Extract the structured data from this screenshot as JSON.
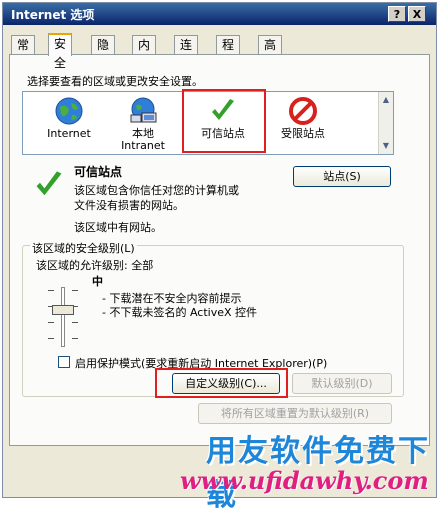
{
  "window": {
    "title": "Internet 选项",
    "help_glyph": "?",
    "close_glyph": "X"
  },
  "tabs": [
    {
      "label": "常规"
    },
    {
      "label": "安全"
    },
    {
      "label": "隐私"
    },
    {
      "label": "内容"
    },
    {
      "label": "连接"
    },
    {
      "label": "程序"
    },
    {
      "label": "高级"
    }
  ],
  "zones_heading": "选择要查看的区域或更改安全设置。",
  "zones": [
    {
      "label": "Internet",
      "icon": "globe-icon"
    },
    {
      "label": "本地\nIntranet",
      "icon": "intranet-icon"
    },
    {
      "label": "可信站点",
      "icon": "checkmark-icon"
    },
    {
      "label": "受限站点",
      "icon": "restricted-icon"
    }
  ],
  "selected_zone": {
    "title": "可信站点",
    "desc_line1": "该区域包含你信任对您的计算机或",
    "desc_line2": "文件没有损害的网站。",
    "desc_line3": "该区域中有网站。",
    "sites_button": "站点(S)"
  },
  "security_level": {
    "group_label": "该区域的安全级别(L)",
    "allowed": "该区域的允许级别: 全部",
    "level": "中",
    "bullet1": "- 下载潜在不安全内容前提示",
    "bullet2": "- 不下载未签名的 ActiveX 控件"
  },
  "protected_mode": {
    "label": "启用保护模式(要求重新启动 Internet Explorer)(P)",
    "checked": false
  },
  "buttons": {
    "custom_level": "自定义级别(C)...",
    "default_level": "默认级别(D)",
    "reset_all": "将所有区域重置为默认级别(R)"
  },
  "watermark": {
    "cn": "用友软件免费下载",
    "en": "www.ufidawhy.com"
  },
  "colors": {
    "title_bar": "#0a246a",
    "highlight_red": "#e02020",
    "watermark_blue": "#1e86d8",
    "watermark_pink": "#e02080"
  }
}
